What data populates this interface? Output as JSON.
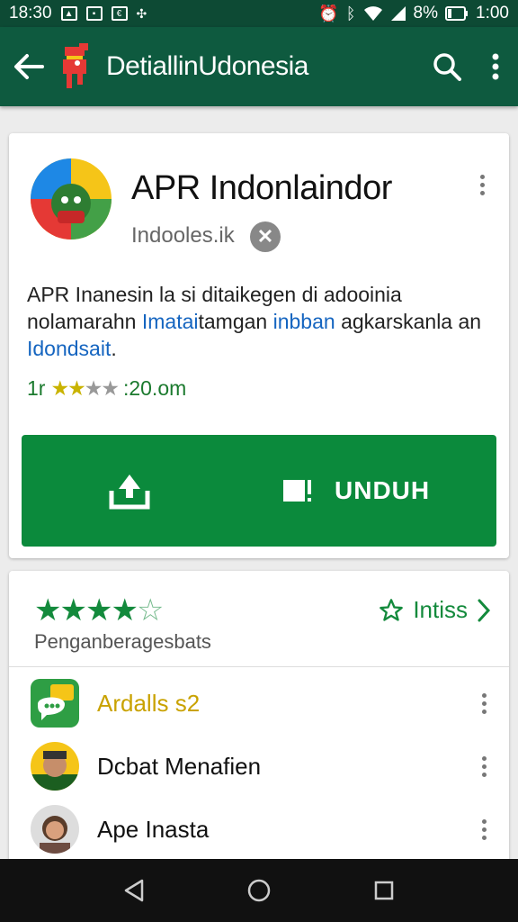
{
  "status_bar": {
    "time_left": "18:30",
    "battery_percent": "8%",
    "time_right": "1:00"
  },
  "toolbar": {
    "title": "DetiallinUdonesia"
  },
  "app": {
    "title": "APR Indonlaindor",
    "developer": "Indooles.ik",
    "description_part1": "APR Inanesin la si ditaikegen di adooinia nolamarahn ",
    "description_link1": "Imatai",
    "description_part2": "tamgan ",
    "description_link2": "inbban",
    "description_part3": " agkarskanla an ",
    "description_link3": "Idondsait",
    "description_part4": ".",
    "rating_prefix": "1r",
    "rating_count": ":20.om",
    "rating_value": 2.5,
    "install_label": "UNDUH"
  },
  "reviews": {
    "rating_value": 3.5,
    "subtitle": "Penganberagesbats",
    "install_link_label": "Intiss"
  },
  "similar_items": [
    {
      "label": "Ardalls s2"
    },
    {
      "label": "Dcbat Menafien"
    },
    {
      "label": "Ape Inasta"
    }
  ],
  "colors": {
    "status_bar": "#0d4a34",
    "toolbar": "#0e5a3f",
    "install_button": "#0b8a3c",
    "link": "#1565c0",
    "accent_green": "#138a3c"
  },
  "icons": {
    "back": "arrow-left-icon",
    "search": "search-icon",
    "menu": "more-vert-icon",
    "download": "download-icon",
    "wishlist": "bookmark-icon",
    "star": "star-icon",
    "chevron": "chevron-right-icon"
  }
}
